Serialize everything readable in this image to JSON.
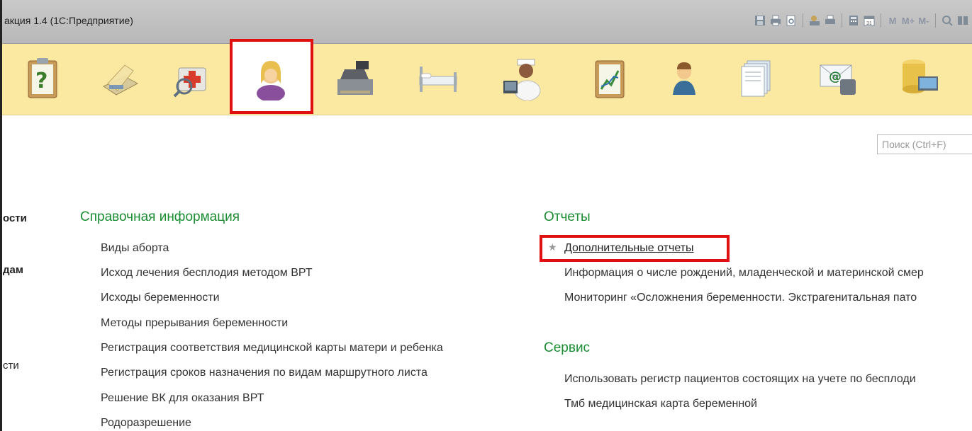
{
  "window": {
    "title": "акция 1.4  (1С:Предприятие)"
  },
  "toolbar": {
    "icons": [
      "save-icon",
      "print-icon",
      "preview-icon",
      "upload-icon",
      "print-preview-icon",
      "calculator-icon",
      "calendar-icon"
    ],
    "memory_buttons": [
      "M",
      "M+",
      "M-"
    ],
    "extra_icons": [
      "zoom-icon",
      "panel-icon"
    ]
  },
  "sections": {
    "icons": [
      "help-clipboard-icon",
      "documents-tray-icon",
      "first-aid-search-icon",
      "patient-woman-icon",
      "cash-register-icon",
      "hospital-bed-icon",
      "doctor-computer-icon",
      "chart-report-icon",
      "user-icon",
      "documents-stack-icon",
      "email-phone-icon",
      "database-monitor-icon"
    ],
    "highlight_color": "#e01010"
  },
  "search": {
    "placeholder": "Поиск (Ctrl+F)"
  },
  "left_menu": {
    "items": [
      "ости",
      "дам",
      "сти"
    ]
  },
  "reference": {
    "title": "Справочная информация",
    "items": [
      "Виды аборта",
      "Исход лечения бесплодия методом ВРТ",
      "Исходы беременности",
      "Методы прерывания беременности",
      "Регистрация соответствия медицинской карты матери и ребенка",
      "Регистрация сроков назначения по видам маршрутного листа",
      "Решение ВК для оказания ВРТ",
      "Родоразрешение"
    ]
  },
  "reports": {
    "title": "Отчеты",
    "items": [
      "Дополнительные отчеты",
      "Информация о числе рождений, младенческой и материнской смер",
      "Мониторинг «Осложнения беременности. Экстрагенитальная пато"
    ]
  },
  "service": {
    "title": "Сервис",
    "items": [
      "Использовать регистр пациентов состоящих на учете по бесплоди",
      "Тмб медицинская карта беременной"
    ]
  },
  "colors": {
    "section_title": "#1a8c32",
    "panel_bg": "#fbe9a2",
    "highlight": "#e01010"
  }
}
